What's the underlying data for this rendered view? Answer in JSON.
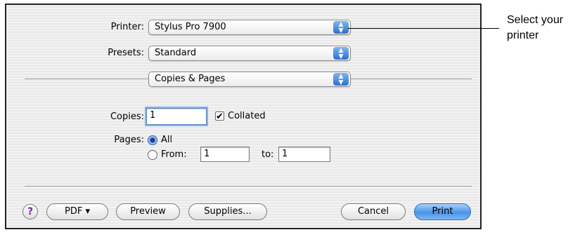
{
  "dialog": {
    "printer": {
      "label": "Printer:",
      "value": "Stylus Pro 7900"
    },
    "presets": {
      "label": "Presets:",
      "value": "Standard"
    },
    "panel": {
      "value": "Copies & Pages"
    },
    "copies": {
      "label": "Copies:",
      "value": "1",
      "collated_label": "Collated",
      "collated": true
    },
    "pages": {
      "label": "Pages:",
      "all_label": "All",
      "from_label": "From:",
      "from_value": "1",
      "to_label": "to:",
      "to_value": "1",
      "selected": "All"
    },
    "buttons": {
      "help": "?",
      "pdf": "PDF ▾",
      "preview": "Preview",
      "supplies": "Supplies...",
      "cancel": "Cancel",
      "print": "Print"
    }
  },
  "callout": {
    "line1": "Select your",
    "line2": "printer"
  },
  "icons": {
    "popup_arrow": "up-down-arrows-icon",
    "check": "checkmark-icon",
    "help": "help-icon"
  }
}
